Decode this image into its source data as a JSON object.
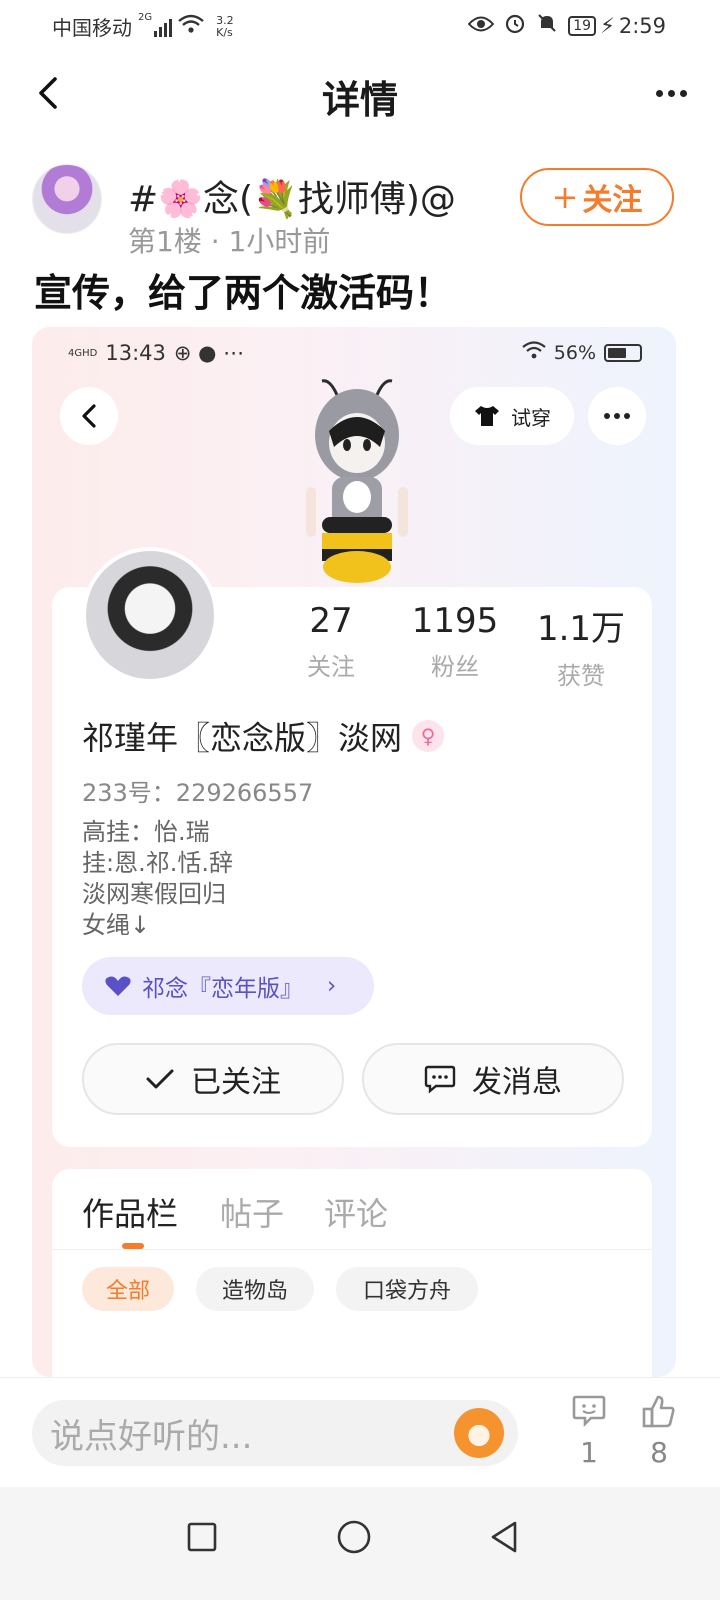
{
  "status_bar": {
    "carrier": "中国移动",
    "network": "2G",
    "speed_value": "3.2",
    "speed_unit": "K/s",
    "battery": "19",
    "time": "2:59"
  },
  "header": {
    "title": "详情"
  },
  "post": {
    "author_name": "#🌸念(💐找师傅)@",
    "meta": "第1楼 · 1小时前",
    "follow_label": "关注",
    "text": "宣传，给了两个激活码！"
  },
  "embedded": {
    "status_time": "13:43",
    "status_net": "4GHD",
    "battery_pct": "56%",
    "try_on_label": "试穿",
    "stats": [
      {
        "value": "27",
        "label": "关注"
      },
      {
        "value": "1195",
        "label": "粉丝"
      },
      {
        "value": "1.1万",
        "label": "获赞"
      }
    ],
    "nickname": "祁瑾年〖恋念版〗淡网",
    "uid": "233号：229266557",
    "bio_lines": [
      "高挂：怡.瑞",
      "挂:恩.祁.恬.辞",
      "淡网寒假回归",
      "女绳↓"
    ],
    "fan_group": "祁念『恋年版』",
    "followed_label": "已关注",
    "message_label": "发消息",
    "tabs": [
      "作品栏",
      "帖子",
      "评论"
    ],
    "filters": [
      "全部",
      "造物岛",
      "口袋方舟"
    ]
  },
  "comment_bar": {
    "placeholder": "说点好听的...",
    "comment_count": "1",
    "like_count": "8"
  },
  "colors": {
    "accent": "#f57c2a",
    "fan_chip_text": "#5a51c7"
  }
}
